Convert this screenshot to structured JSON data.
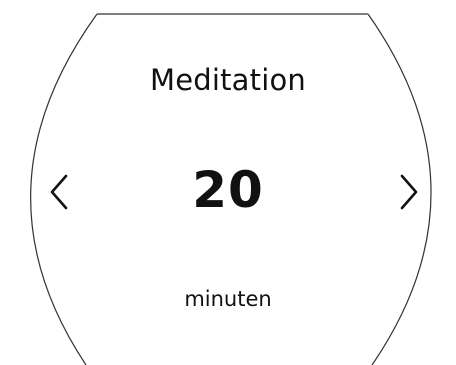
{
  "screen": {
    "title": "Meditation",
    "value": "20",
    "unit": "minuten"
  },
  "icons": {
    "previous": "chevron-left-icon",
    "next": "chevron-right-icon"
  },
  "colors": {
    "background": "#ffffff",
    "foreground": "#111111",
    "outline": "#333333"
  }
}
